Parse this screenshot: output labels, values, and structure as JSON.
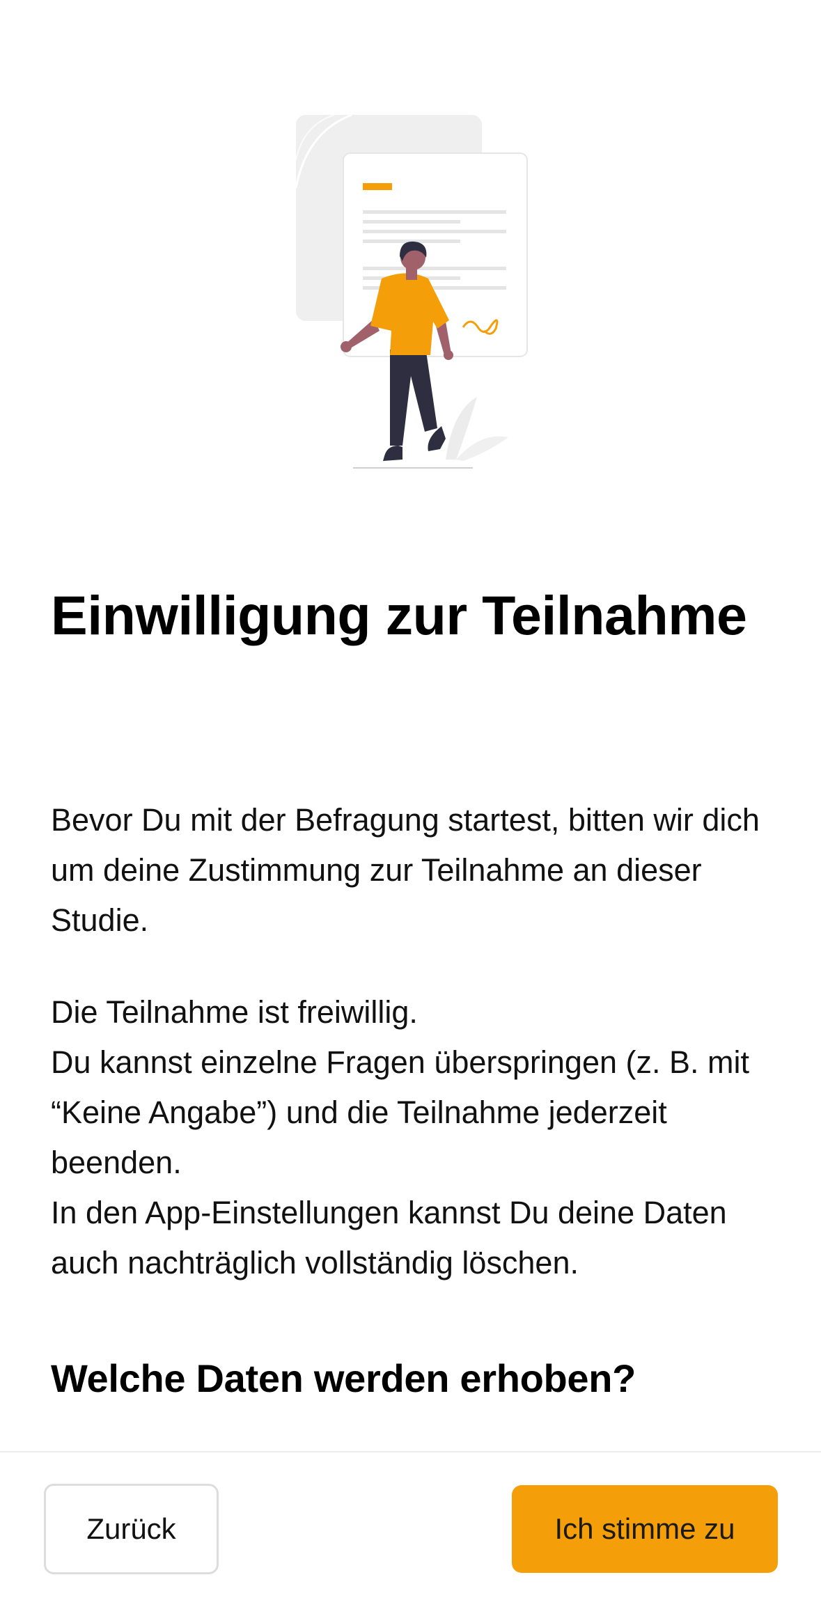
{
  "illustration": {
    "icon": "consent-document-person-illustration",
    "accent_color": "#f49f0a"
  },
  "page": {
    "title": "Einwilligung zur Teilnahme",
    "paragraph1": "Bevor Du mit der Befragung startest, bitten wir dich um deine Zustimmung zur Teilnahme an dieser Studie.",
    "paragraph2": "Die Teilnahme ist freiwillig.\nDu kannst einzelne Fragen überspringen (z. B. mit “Keine Angabe”) und die Teilnahme jederzeit beenden.\nIn den App-Einstellungen kannst Du deine Daten auch nachträglich vollständig löschen.",
    "section_heading": "Welche Daten werden erhoben?"
  },
  "footer": {
    "back_label": "Zurück",
    "agree_label": "Ich stimme zu",
    "agree_color": "#f49f0a"
  }
}
